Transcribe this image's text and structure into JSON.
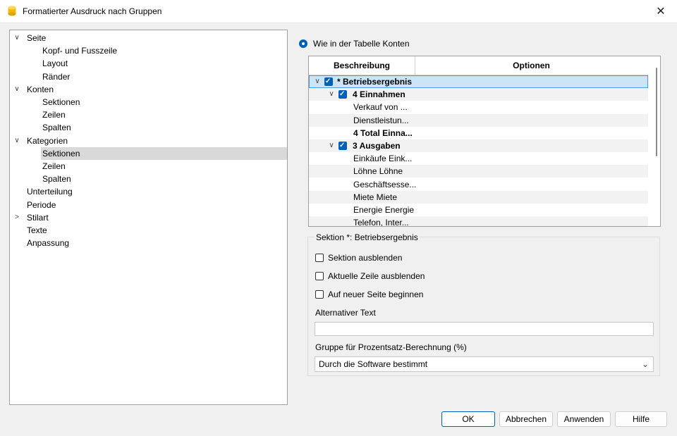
{
  "window": {
    "title": "Formatierter Ausdruck nach Gruppen",
    "close_glyph": "✕",
    "icon": "database-icon"
  },
  "tree": {
    "items": [
      {
        "label": "Seite",
        "expander": "∨"
      },
      {
        "label": "Kopf- und Fusszeile"
      },
      {
        "label": "Layout"
      },
      {
        "label": "Ränder"
      },
      {
        "label": "Konten",
        "expander": "∨"
      },
      {
        "label": "Sektionen"
      },
      {
        "label": "Zeilen"
      },
      {
        "label": "Spalten"
      },
      {
        "label": "Kategorien",
        "expander": "∨"
      },
      {
        "label": "Sektionen",
        "selected": true
      },
      {
        "label": "Zeilen"
      },
      {
        "label": "Spalten"
      },
      {
        "label": "Unterteilung"
      },
      {
        "label": "Periode"
      },
      {
        "label": "Stilart",
        "expander": ">"
      },
      {
        "label": "Texte"
      },
      {
        "label": "Anpassung"
      }
    ]
  },
  "radio": {
    "label": "Wie in der Tabelle Konten",
    "checked": true
  },
  "grid": {
    "columns": [
      "Beschreibung",
      "Optionen"
    ],
    "rows": [
      {
        "label": "* Betriebsergebnis",
        "bold": true,
        "checkbox": true,
        "expander": "∨",
        "selected": true
      },
      {
        "label": "4 Einnahmen",
        "bold": true,
        "checkbox": true,
        "expander": "∨"
      },
      {
        "label": "Verkauf von ..."
      },
      {
        "label": "Dienstleistun..."
      },
      {
        "label": "4 Total Einna...",
        "bold": true
      },
      {
        "label": "3 Ausgaben",
        "bold": true,
        "checkbox": true,
        "expander": "∨"
      },
      {
        "label": "Einkäufe Eink..."
      },
      {
        "label": "Löhne Löhne"
      },
      {
        "label": "Geschäftsesse..."
      },
      {
        "label": "Miete Miete"
      },
      {
        "label": "Energie Energie"
      },
      {
        "label": "Telefon, Inter..."
      }
    ]
  },
  "section": {
    "title": "Sektion *: Betriebsergebnis",
    "options": [
      {
        "label": "Sektion ausblenden",
        "checked": false
      },
      {
        "label": "Aktuelle Zeile ausblenden",
        "checked": false
      },
      {
        "label": "Auf neuer Seite beginnen",
        "checked": false
      }
    ],
    "alt_text_label": "Alternativer Text",
    "alt_text_value": "",
    "percent_group_label": "Gruppe für Prozentsatz-Berechnung (%)",
    "percent_group_value": "Durch die Software bestimmt"
  },
  "buttons": {
    "ok": "OK",
    "cancel": "Abbrechen",
    "apply": "Anwenden",
    "help": "Hilfe"
  },
  "colors": {
    "accent": "#005fb8",
    "selection": "#cce4f7",
    "tree_selection": "#d9d9d9",
    "icon_yellow": "#f2b705"
  }
}
